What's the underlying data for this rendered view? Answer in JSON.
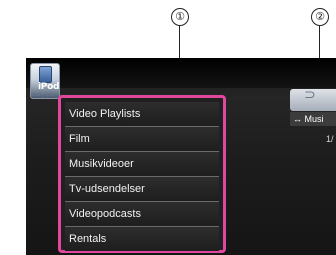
{
  "callouts": {
    "first": "①",
    "second": "②"
  },
  "source": {
    "label": "iPod",
    "icon": "ipod-icon",
    "clock": "--:--"
  },
  "menu": {
    "items": [
      {
        "label": "Video Playlists"
      },
      {
        "label": "Film"
      },
      {
        "label": "Musikvideoer"
      },
      {
        "label": "Tv-udsendelser"
      },
      {
        "label": "Videopodcasts"
      },
      {
        "label": "Rentals"
      }
    ]
  },
  "right_panel": {
    "music_tab": "↔ Musi",
    "page": "1/",
    "repeat_icon": "repeat-icon"
  },
  "colors": {
    "highlight": "#e0479d",
    "background": "#1c1c1c",
    "text": "#f2f2f2"
  }
}
